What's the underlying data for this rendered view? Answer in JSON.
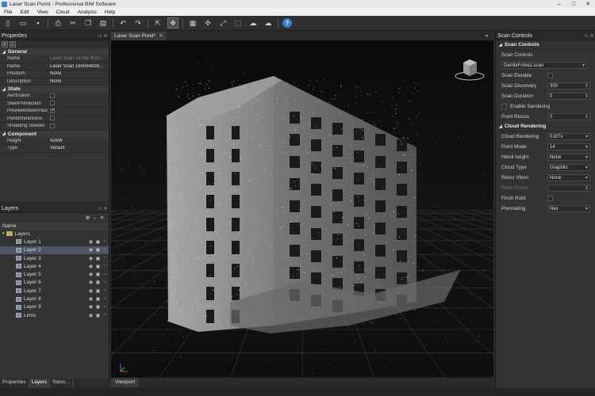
{
  "window": {
    "title": "Laser Scan Ponnt - Professional BIM Software",
    "controls": [
      "–",
      "□",
      "✕"
    ]
  },
  "menu": [
    "File",
    "Edit",
    "View",
    "Cloud",
    "Analysis",
    "Help"
  ],
  "toolbar": {
    "icons": [
      "new-file-icon",
      "open-folder-icon",
      "save-icon",
      "print-icon",
      "cut-icon",
      "copy-icon",
      "paste-icon",
      "undo-icon",
      "redo-icon",
      "select-icon",
      "move-icon",
      "grid-icon",
      "transform-icon",
      "measure-icon",
      "clip-box-icon",
      "cloud-import-icon",
      "cloud-export-icon",
      "help-icon"
    ],
    "help_label": "?"
  },
  "properties": {
    "title": "Properties",
    "sections": [
      {
        "name": "General",
        "rows": [
          {
            "key": "Name",
            "value": "Laser Scan 18796 4/3/0...",
            "dim": true
          },
          {
            "key": "Name",
            "value": "Laser Scan 180064838..."
          },
          {
            "key": "Positiom",
            "value": "None"
          },
          {
            "key": "Description",
            "value": "None"
          }
        ]
      },
      {
        "name": "State",
        "rows": [
          {
            "key": "Aectivation",
            "check": false
          },
          {
            "key": "SteetPrenection",
            "check": false
          },
          {
            "key": "PrewiewSteenPass",
            "check": true
          },
          {
            "key": "Pontshnnancess",
            "check": false
          },
          {
            "key": "Shaeding Steeiter",
            "check": false
          }
        ]
      },
      {
        "name": "Component",
        "rows": [
          {
            "key": "Height",
            "value": "428W"
          },
          {
            "key": "Type",
            "value": "Vefault"
          }
        ]
      }
    ]
  },
  "layers": {
    "title": "Layers",
    "column": "Name",
    "root": "Layers",
    "items": [
      "Layer 1",
      "Layer 2",
      "Layer 3",
      "Layer 4",
      "Layer 5",
      "Layer 6",
      "Layer 7",
      "Layer 8",
      "Layer 9",
      "Limis"
    ],
    "selected_index": 1
  },
  "left_tabs": [
    "Properties",
    "Layers",
    "Sidos..."
  ],
  "viewport": {
    "tab": "Laser Scan Ponit*",
    "bottom_tab": "Viewport"
  },
  "scan_controls": {
    "title": "Scan Controls",
    "section1": "Scan Controls",
    "scan_controls_label": "Scan Controls",
    "scan_file": "GentleFrimez.scan",
    "rows1": [
      {
        "label": "Scan Elviable",
        "type": "check"
      },
      {
        "label": "Scan Disonvary",
        "type": "spin",
        "value": "300"
      },
      {
        "label": "Scan Duration",
        "type": "spin",
        "value": "0"
      },
      {
        "label": "Enable Sandering",
        "type": "checklabel"
      },
      {
        "label": "Point Riosss",
        "type": "spin",
        "value": "0"
      }
    ],
    "section2": "Cloud Rendering",
    "rows2": [
      {
        "label": "Cloud Rendering",
        "type": "select",
        "value": "0.8/Tx"
      },
      {
        "label": "Point Mode",
        "type": "select",
        "value": "14"
      },
      {
        "label": "Heisil height",
        "type": "select",
        "value": "None"
      },
      {
        "label": "Cloud Type",
        "type": "select",
        "value": "Graphits"
      },
      {
        "label": "Retox Vition",
        "type": "select",
        "value": "None"
      },
      {
        "label": "Point Sones",
        "type": "spin",
        "value": "",
        "dim": true
      },
      {
        "label": "Finsh Robt",
        "type": "check"
      },
      {
        "label": "Prennating",
        "type": "select",
        "value": "Nex"
      }
    ]
  }
}
